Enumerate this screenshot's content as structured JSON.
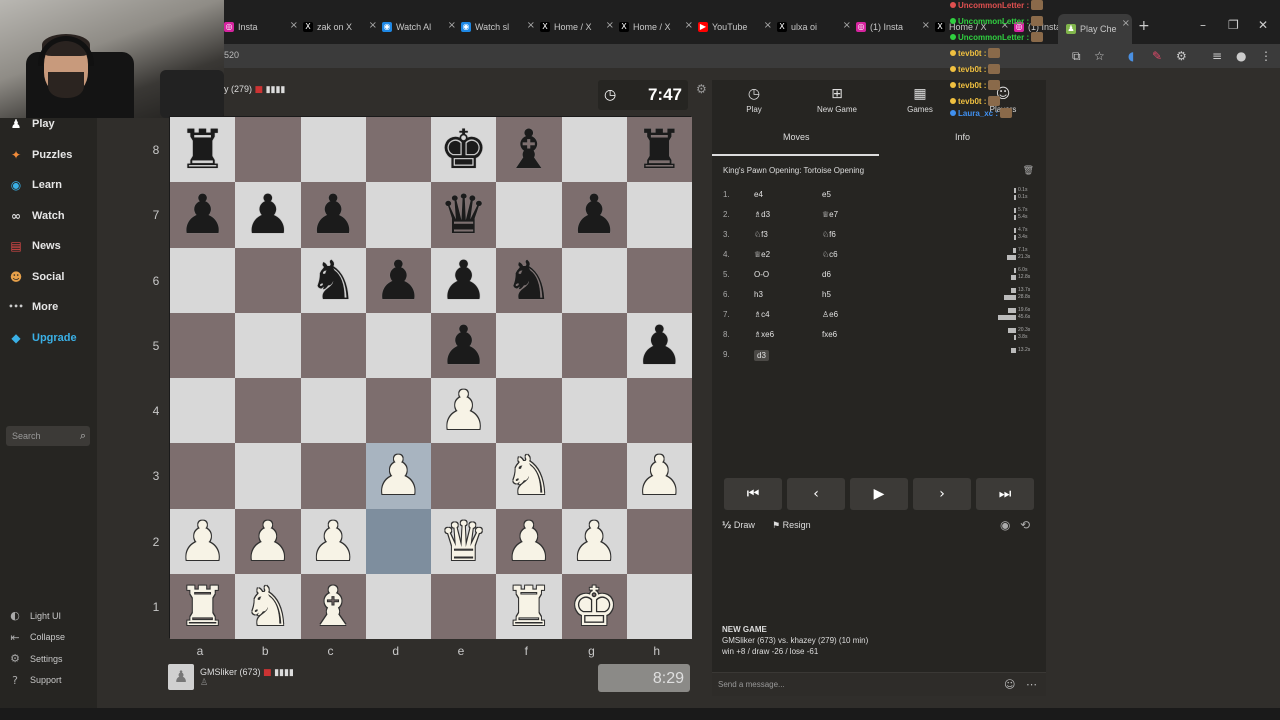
{
  "browser": {
    "tabs": [
      {
        "label": "Insta",
        "icon": "instagram-icon",
        "color": "#d6249f"
      },
      {
        "label": "zak on X",
        "icon": "x-icon",
        "color": "#000000"
      },
      {
        "label": "Watch Al",
        "icon": "watch-icon",
        "color": "#1e88e5"
      },
      {
        "label": "Watch sl",
        "icon": "watch-icon",
        "color": "#1e88e5"
      },
      {
        "label": "Home / X",
        "icon": "x-icon",
        "color": "#000000"
      },
      {
        "label": "Home / X",
        "icon": "x-icon",
        "color": "#000000"
      },
      {
        "label": "YouTube",
        "icon": "youtube-icon",
        "color": "#ff0000"
      },
      {
        "label": "ulxa oi",
        "icon": "x-icon",
        "color": "#000000"
      },
      {
        "label": "(1) Insta",
        "icon": "instagram-icon",
        "color": "#d6249f"
      },
      {
        "label": "Home / X",
        "icon": "x-icon",
        "color": "#000000"
      },
      {
        "label": "(1) Insta",
        "icon": "instagram-icon",
        "color": "#d6249f"
      }
    ],
    "active_tab": "Play Che",
    "url": "520"
  },
  "nav": {
    "items": [
      {
        "label": "Play",
        "icon": "pawn-icon",
        "color": "#ffffff"
      },
      {
        "label": "Puzzles",
        "icon": "puzzle-icon",
        "color": "#f08b3a"
      },
      {
        "label": "Learn",
        "icon": "learn-icon",
        "color": "#3ab0e6"
      },
      {
        "label": "Watch",
        "icon": "binoculars-icon",
        "color": "#dddddd"
      },
      {
        "label": "News",
        "icon": "news-icon",
        "color": "#e64a4a"
      },
      {
        "label": "Social",
        "icon": "social-icon",
        "color": "#e6a04a"
      },
      {
        "label": "More",
        "icon": "more-icon",
        "color": "#cccccc"
      },
      {
        "label": "Upgrade",
        "icon": "diamond-icon",
        "color": "#3ab0e6"
      }
    ],
    "search_placeholder": "Search",
    "footer": [
      {
        "label": "Light UI",
        "icon": "light-ui-icon"
      },
      {
        "label": "Collapse",
        "icon": "collapse-icon"
      },
      {
        "label": "Settings",
        "icon": "gear-icon"
      },
      {
        "label": "Support",
        "icon": "help-icon"
      }
    ]
  },
  "game": {
    "top_player": "y (279)",
    "top_clock": "7:47",
    "bottom_player": "GMSliker (673)",
    "bottom_clock": "8:29",
    "ranks": [
      "8",
      "7",
      "6",
      "5",
      "4",
      "3",
      "2",
      "1"
    ],
    "files": [
      "a",
      "b",
      "c",
      "d",
      "e",
      "f",
      "g",
      "h"
    ],
    "board": [
      [
        "bR",
        "",
        "",
        "",
        "bK",
        "bB",
        "",
        "bR"
      ],
      [
        "bP",
        "bP",
        "bP",
        "",
        "bQ",
        "",
        "bP",
        ""
      ],
      [
        "",
        "",
        "bN",
        "bP",
        "bP",
        "bN",
        "",
        ""
      ],
      [
        "",
        "",
        "",
        "",
        "bP",
        "",
        "",
        "bP"
      ],
      [
        "",
        "",
        "",
        "",
        "wP",
        "",
        "",
        ""
      ],
      [
        "",
        "",
        "",
        "wP",
        "",
        "wN",
        "",
        "wP"
      ],
      [
        "wP",
        "wP",
        "wP",
        "",
        "wQ",
        "wP",
        "wP",
        ""
      ],
      [
        "wR",
        "wN",
        "wB",
        "",
        "",
        "wR",
        "wK",
        ""
      ]
    ],
    "highlight": [
      "d3",
      "d2"
    ]
  },
  "panel": {
    "tabs": [
      {
        "label": "Play",
        "icon": "clock-icon"
      },
      {
        "label": "New Game",
        "icon": "plus-icon"
      },
      {
        "label": "Games",
        "icon": "board-icon"
      },
      {
        "label": "Players",
        "icon": "players-icon"
      }
    ],
    "subtabs": [
      "Moves",
      "Info"
    ],
    "opening": "King's Pawn Opening: Tortoise Opening",
    "moves": [
      {
        "n": "1.",
        "w": "e4",
        "b": "e5",
        "tw": "0.1s",
        "tb": "0.1s"
      },
      {
        "n": "2.",
        "w": "♗d3",
        "b": "♕e7",
        "tw": "5.7s",
        "tb": "5.4s"
      },
      {
        "n": "3.",
        "w": "♘f3",
        "b": "♘f6",
        "tw": "4.7s",
        "tb": "3.4s"
      },
      {
        "n": "4.",
        "w": "♕e2",
        "b": "♘c6",
        "tw": "7.1s",
        "tb": "21.3s"
      },
      {
        "n": "5.",
        "w": "O-O",
        "b": "d6",
        "tw": "6.0s",
        "tb": "12.8s"
      },
      {
        "n": "6.",
        "w": "h3",
        "b": "h5",
        "tw": "13.7s",
        "tb": "28.8s"
      },
      {
        "n": "7.",
        "w": "♗c4",
        "b": "♙e6",
        "tw": "19.6s",
        "tb": "45.6s"
      },
      {
        "n": "8.",
        "w": "♗xe6",
        "b": "fxe6",
        "tw": "20.3s",
        "tb": "3.8s"
      },
      {
        "n": "9.",
        "w": "d3",
        "b": "",
        "tw": "13.2s",
        "tb": ""
      }
    ],
    "controls": [
      "first-move",
      "previous-move",
      "play",
      "next-move",
      "last-move"
    ],
    "draw": "Draw",
    "resign": "Resign",
    "new_game_header": "NEW GAME",
    "new_game_players": "GMSliker (673) vs. khazey (279) (10 min)",
    "new_game_result": "win +8 / draw -26 / lose -61",
    "message_placeholder": "Send a message..."
  },
  "chat": [
    {
      "name": "UncommonLetter :",
      "color": "#e05050"
    },
    {
      "name": "UncommonLetter :",
      "color": "#30d040"
    },
    {
      "name": "UncommonLetter :",
      "color": "#30d040"
    },
    {
      "name": "tevb0t :",
      "color": "#f0c040"
    },
    {
      "name": "tevb0t :",
      "color": "#f0c040"
    },
    {
      "name": "tevb0t :",
      "color": "#f0c040"
    },
    {
      "name": "tevb0t :",
      "color": "#f0c040"
    },
    {
      "name": "Laura_xc :",
      "color": "#4090f0"
    }
  ],
  "colors": {
    "board_light": "#d8d8d8",
    "board_dark": "#7d6e6e",
    "highlight": "#8e9eae",
    "accent": "#3ab0e6"
  }
}
